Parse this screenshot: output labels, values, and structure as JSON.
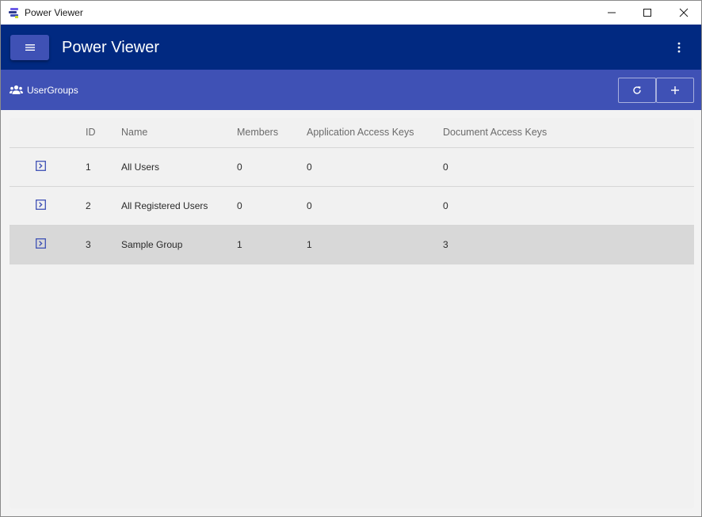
{
  "window": {
    "title": "Power Viewer"
  },
  "appbar": {
    "title": "Power Viewer"
  },
  "toolbar": {
    "page_title": "UserGroups"
  },
  "table": {
    "columns": [
      "ID",
      "Name",
      "Members",
      "Application Access Keys",
      "Document Access Keys"
    ],
    "rows": [
      {
        "id": "1",
        "name": "All Users",
        "members": "0",
        "app_keys": "0",
        "doc_keys": "0"
      },
      {
        "id": "2",
        "name": "All Registered Users",
        "members": "0",
        "app_keys": "0",
        "doc_keys": "0"
      },
      {
        "id": "3",
        "name": "Sample Group",
        "members": "1",
        "app_keys": "1",
        "doc_keys": "3"
      }
    ],
    "selected_row": 2
  },
  "icons": {
    "app": "power-viewer-logo-icon",
    "minimize": "minimize-icon",
    "maximize": "maximize-icon",
    "close": "close-icon",
    "menu": "hamburger-menu-icon",
    "more": "more-vertical-icon",
    "page": "user-group-icon",
    "refresh": "refresh-icon",
    "add": "plus-icon",
    "expand": "expand-row-icon"
  },
  "colors": {
    "appbar": "#012981",
    "toolbar": "#3f51b5",
    "menu_button": "#3f51b5",
    "selected_row": "#d8d8d8",
    "accent_icon": "#3f51b5"
  }
}
